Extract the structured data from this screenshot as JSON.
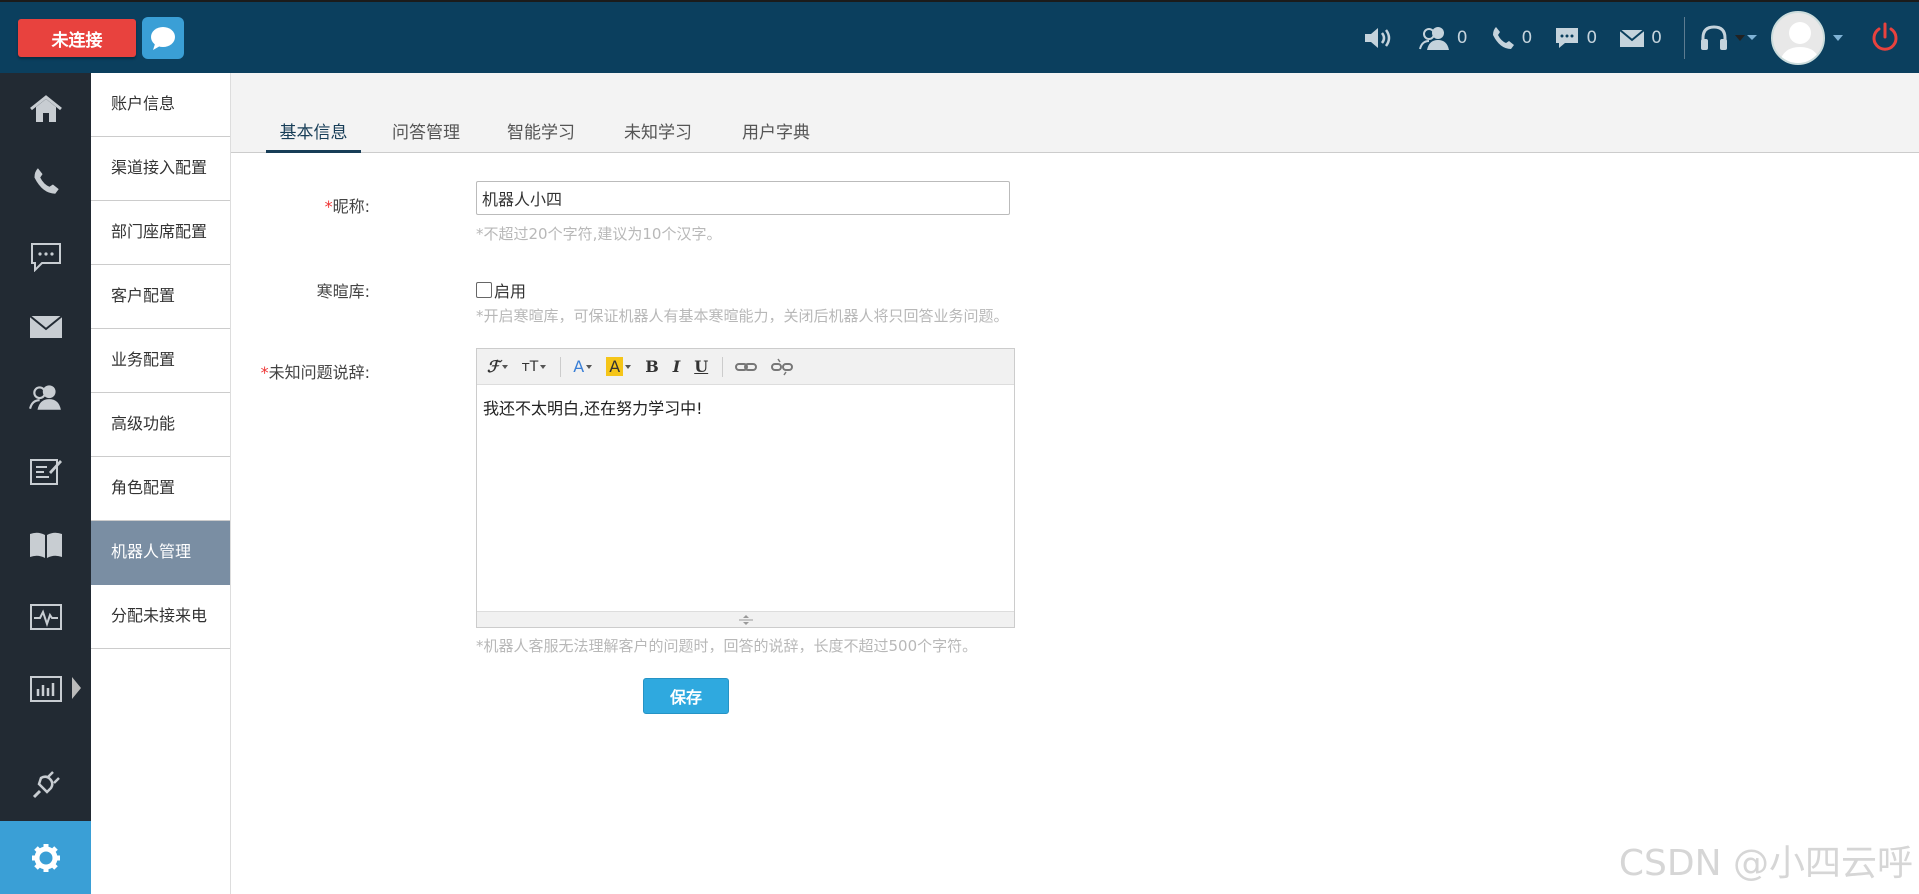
{
  "topbar": {
    "status_button": "未连接",
    "counters": {
      "agents": "0",
      "calls": "0",
      "messages": "0",
      "emails": "0"
    }
  },
  "nav_icons": [
    "home-icon",
    "phone-icon",
    "chat-icon",
    "mail-icon",
    "users-icon",
    "edit-note-icon",
    "book-icon",
    "monitor-icon",
    "stats-icon",
    "plugin-icon",
    "gear-icon"
  ],
  "submenu": {
    "items": [
      "账户信息",
      "渠道接入配置",
      "部门座席配置",
      "客户配置",
      "业务配置",
      "高级功能",
      "角色配置",
      "机器人管理",
      "分配未接来电"
    ]
  },
  "tabs": [
    "基本信息",
    "问答管理",
    "智能学习",
    "未知学习",
    "用户字典"
  ],
  "form": {
    "nickname": {
      "required": "*",
      "label": "昵称:",
      "value": "机器人小四",
      "hint": "*不超过20个字符,建议为10个汉字。"
    },
    "smalltalk": {
      "label": "寒暄库:",
      "checkbox_label": "启用",
      "hint": "*开启寒暄库，可保证机器人有基本寒暄能力，关闭后机器人将只回答业务问题。"
    },
    "unknown": {
      "required": "*",
      "label": "未知问题说辞:",
      "content": "我还不太明白,还在努力学习中!",
      "hint": "*机器人客服无法理解客户的问题时，回答的说辞，长度不超过500个字符。"
    },
    "save_label": "保存"
  },
  "watermark": "CSDN @小四云呼",
  "colors": {
    "topbar": "#0b3f5e",
    "status": "#e8423e",
    "accent": "#3a9fd6",
    "sidebar": "#222a33",
    "submenu_active": "#7a8ea3"
  }
}
